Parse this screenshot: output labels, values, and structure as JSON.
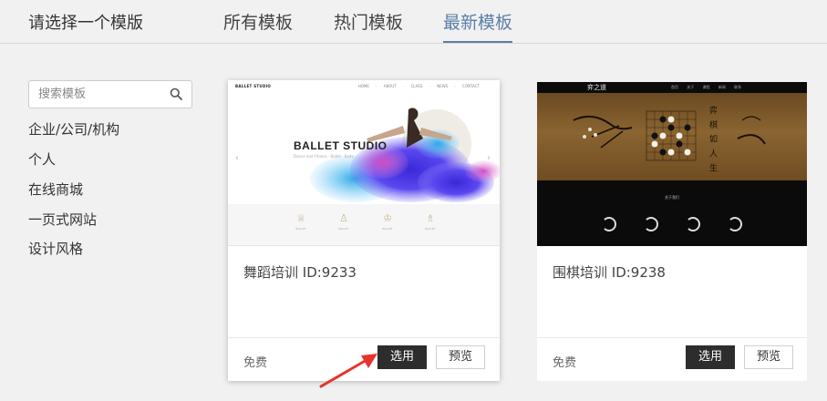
{
  "header": {
    "title": "请选择一个模版",
    "tabs": [
      {
        "label": "所有模板",
        "active": false
      },
      {
        "label": "热门模板",
        "active": false
      },
      {
        "label": "最新模板",
        "active": true
      }
    ],
    "accent_color": "#5b7fa9"
  },
  "sidebar": {
    "search": {
      "placeholder": "搜索模板",
      "value": "",
      "icon": "search-icon"
    },
    "categories": [
      {
        "label": "企业/公司/机构"
      },
      {
        "label": "个人"
      },
      {
        "label": "在线商城"
      },
      {
        "label": "一页式网站"
      },
      {
        "label": "设计风格"
      }
    ]
  },
  "templates": [
    {
      "title": "舞蹈培训 ID:9233",
      "price": "免费",
      "select_label": "选用",
      "preview_label": "预览",
      "thumbnail": {
        "logo": "BALLET STUDIO",
        "menu": "HOME · ABOUT · CLASS · NEWS · CONTACT",
        "hero_title": "BALLET STUDIO",
        "hero_subtitle": "Dance and Fitness · Ballet · Body",
        "prev_arrow": "‹",
        "next_arrow": "›",
        "features": [
          {
            "glyph": "♕",
            "label": "BALLET"
          },
          {
            "glyph": "♙",
            "label": "BALLET"
          },
          {
            "glyph": "♔",
            "label": "BALLET"
          },
          {
            "glyph": "♗",
            "label": "BALLET"
          }
        ]
      }
    },
    {
      "title": "围棋培训 ID:9238",
      "price": "免费",
      "select_label": "选用",
      "preview_label": "预览",
      "thumbnail": {
        "logo": "弈之道",
        "menu": "首页 关于 课程 新闻 联系",
        "caption": "关于我们",
        "calligraphy": "弈 棋 如 人 生"
      }
    }
  ]
}
